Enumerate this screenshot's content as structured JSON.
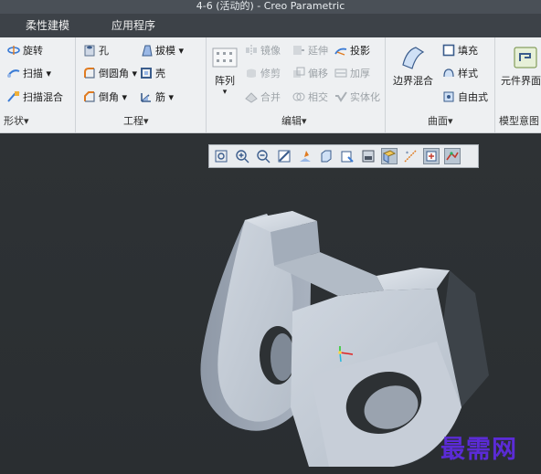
{
  "window": {
    "title": "4-6 (活动的) - Creo Parametric"
  },
  "tabs": [
    {
      "label": "柔性建模"
    },
    {
      "label": "应用程序"
    }
  ],
  "ribbon": {
    "shape_group": {
      "label": "形状▾",
      "items": [
        {
          "label": "旋转",
          "icon": "revolve-icon"
        },
        {
          "label": "扫描 ▾",
          "icon": "sweep-icon"
        },
        {
          "label": "扫描混合",
          "icon": "swept-blend-icon"
        }
      ]
    },
    "engineering_group": {
      "label": "工程▾",
      "items": [
        {
          "label": "孔",
          "icon": "hole-icon"
        },
        {
          "label": "倒圆角 ▾",
          "icon": "round-icon"
        },
        {
          "label": "倒角 ▾",
          "icon": "chamfer-icon"
        },
        {
          "label": "拔模 ▾",
          "icon": "draft-icon"
        },
        {
          "label": "壳",
          "icon": "shell-icon"
        },
        {
          "label": "筋 ▾",
          "icon": "rib-icon"
        }
      ]
    },
    "edit_group": {
      "label": "编辑▾",
      "pattern_label": "阵列",
      "pattern_arrow": "▾",
      "items": [
        {
          "label": "镜像",
          "icon": "mirror-icon",
          "enabled": false
        },
        {
          "label": "延伸",
          "icon": "extend-icon",
          "enabled": false
        },
        {
          "label": "投影",
          "icon": "project-icon",
          "enabled": true
        },
        {
          "label": "修剪",
          "icon": "trim-icon",
          "enabled": false
        },
        {
          "label": "偏移",
          "icon": "offset-icon",
          "enabled": false
        },
        {
          "label": "加厚",
          "icon": "thicken-icon",
          "enabled": false
        },
        {
          "label": "合并",
          "icon": "merge-icon",
          "enabled": false
        },
        {
          "label": "相交",
          "icon": "intersect-icon",
          "enabled": false
        },
        {
          "label": "实体化",
          "icon": "solidify-icon",
          "enabled": false
        }
      ]
    },
    "surface_group": {
      "label": "曲面▾",
      "boundary_blend_label": "边界混合",
      "items": [
        {
          "label": "填充",
          "icon": "fill-icon"
        },
        {
          "label": "样式",
          "icon": "style-icon"
        },
        {
          "label": "自由式",
          "icon": "freestyle-icon"
        }
      ]
    },
    "model_intent_group": {
      "label": "模型意图",
      "component_interface_label": "元件界面"
    }
  },
  "view_toolbar": {
    "buttons": [
      {
        "name": "refit-icon",
        "active": false
      },
      {
        "name": "zoom-in-icon",
        "active": false
      },
      {
        "name": "zoom-out-icon",
        "active": false
      },
      {
        "name": "repaint-icon",
        "active": false
      },
      {
        "name": "perspective-icon",
        "active": false
      },
      {
        "name": "display-style-icon",
        "active": false
      },
      {
        "name": "saved-orientations-icon",
        "active": false
      },
      {
        "name": "view-manager-icon",
        "active": false
      },
      {
        "name": "datum-display-icon",
        "active": true
      },
      {
        "name": "annotation-display-icon",
        "active": false
      },
      {
        "name": "spin-center-icon",
        "active": true
      },
      {
        "name": "appearance-icon",
        "active": true
      }
    ]
  },
  "watermark": {
    "text": "最需网"
  },
  "colors": {
    "titlebar": "#4a5057",
    "tabbar": "#3d4248",
    "ribbon": "#eef0f2",
    "viewport": "#2e3235",
    "model_face_light": "#c5ccd6",
    "model_face_mid": "#a9b2bf",
    "model_face_dark": "#8c96a4",
    "watermark": "#5b2bd6"
  }
}
